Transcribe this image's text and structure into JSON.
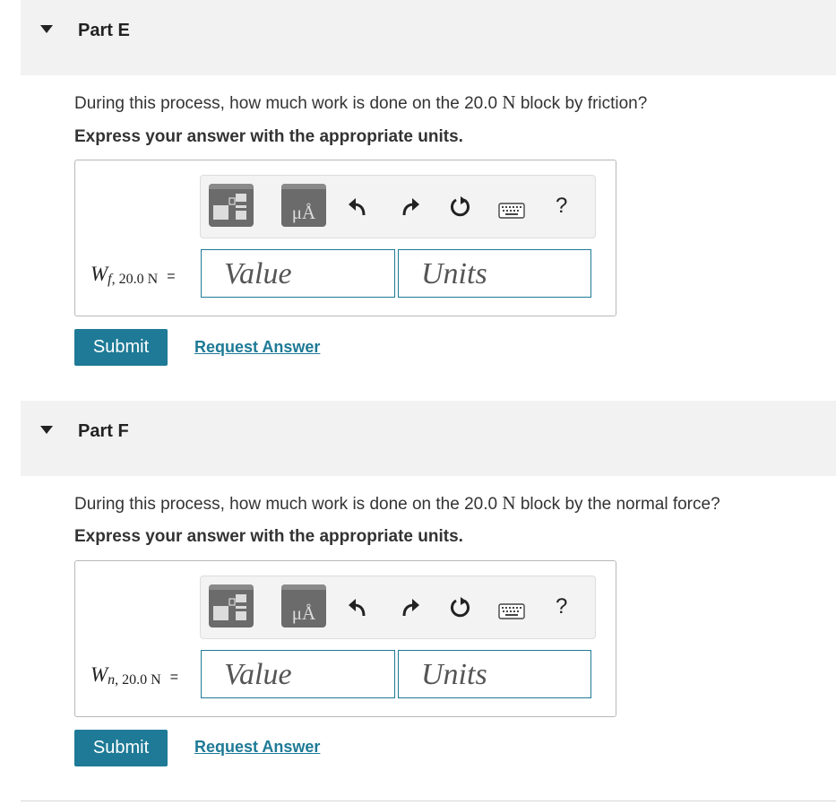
{
  "parts": [
    {
      "title": "Part E",
      "question_before": "During this process, how much work is done on the 20.0",
      "question_unit": "N",
      "question_after": "block by friction?",
      "instruction": "Express your answer with the appropriate units.",
      "variable": {
        "symbol": "W",
        "sub_letter": "f",
        "sub_rest": ", 20.0 N",
        "equals": "="
      },
      "value_placeholder": "Value",
      "units_placeholder": "Units",
      "submit_label": "Submit",
      "request_label": "Request Answer"
    },
    {
      "title": "Part F",
      "question_before": "During this process, how much work is done on the 20.0",
      "question_unit": "N",
      "question_after": "block by the normal force?",
      "instruction": "Express your answer with the appropriate units.",
      "variable": {
        "symbol": "W",
        "sub_letter": "n",
        "sub_rest": ", 20.0 N",
        "equals": "="
      },
      "value_placeholder": "Value",
      "units_placeholder": "Units",
      "submit_label": "Submit",
      "request_label": "Request Answer"
    }
  ],
  "toolbar": {
    "units_symbol": "μÅ",
    "help": "?",
    "icons": [
      "templates-icon",
      "units-icon",
      "undo-icon",
      "redo-icon",
      "reset-icon",
      "keyboard-icon",
      "help-icon"
    ]
  },
  "colors": {
    "accent": "#1e7a96",
    "header_bg": "#f2f2f2",
    "template_button": "#6b6b6b"
  }
}
